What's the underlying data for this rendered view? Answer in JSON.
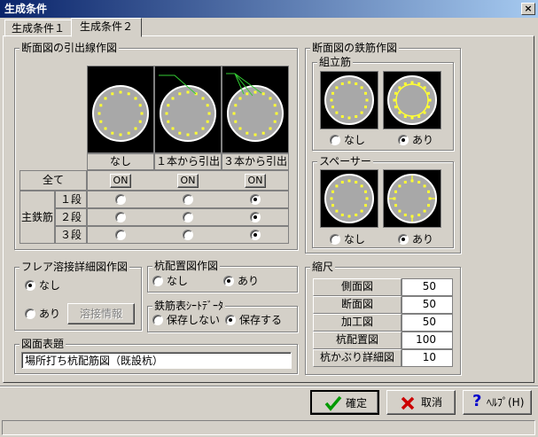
{
  "window": {
    "title": "生成条件",
    "close": "×"
  },
  "tabs": [
    {
      "label": "生成条件１"
    },
    {
      "label": "生成条件２"
    }
  ],
  "leader": {
    "legend": "断面図の引出線作図",
    "columns": [
      "なし",
      "１本から引出",
      "３本から引出"
    ],
    "all_label": "全て",
    "on_label": "ON",
    "main_label": "主鉄筋",
    "rows": [
      {
        "label": "１段",
        "selected": 2
      },
      {
        "label": "２段",
        "selected": 2
      },
      {
        "label": "３段",
        "selected": 2
      }
    ]
  },
  "rebar_drawing": {
    "legend": "断面図の鉄筋作図",
    "assembly": {
      "legend": "組立筋",
      "options": [
        "なし",
        "あり"
      ],
      "selected": 1
    },
    "spacer": {
      "legend": "スペーサー",
      "options": [
        "なし",
        "あり"
      ],
      "selected": 1
    }
  },
  "flare": {
    "legend": "フレア溶接詳細図作図",
    "options": [
      "なし",
      "あり"
    ],
    "selected": 0,
    "info_button": "溶接情報"
  },
  "pile_layout": {
    "legend": "杭配置図作図",
    "options": [
      "なし",
      "あり"
    ],
    "selected": 1
  },
  "rebar_sheet": {
    "legend": "鉄筋表ｼｰﾄﾃﾞｰﾀ",
    "options": [
      "保存しない",
      "保存する"
    ],
    "selected": 1
  },
  "drawing_title": {
    "legend": "図面表題",
    "value": "場所打ち杭配筋図（既設杭）"
  },
  "scale": {
    "legend": "縮尺",
    "rows": [
      {
        "label": "側面図",
        "value": "50"
      },
      {
        "label": "断面図",
        "value": "50"
      },
      {
        "label": "加工図",
        "value": "50"
      },
      {
        "label": "杭配置図",
        "value": "100"
      },
      {
        "label": "杭かぶり詳細図",
        "value": "10"
      }
    ]
  },
  "buttons": {
    "ok": "確定",
    "cancel": "取消",
    "help": "ﾍﾙﾌﾟ(H)"
  },
  "colors": {
    "titlebar": "#0a246a",
    "rebar": "#ffff33",
    "leader": "#33cc33",
    "pile": "#a8a8a8",
    "ok_icon": "#009900",
    "cancel_icon": "#cc0000",
    "help_icon": "#0000cc"
  }
}
